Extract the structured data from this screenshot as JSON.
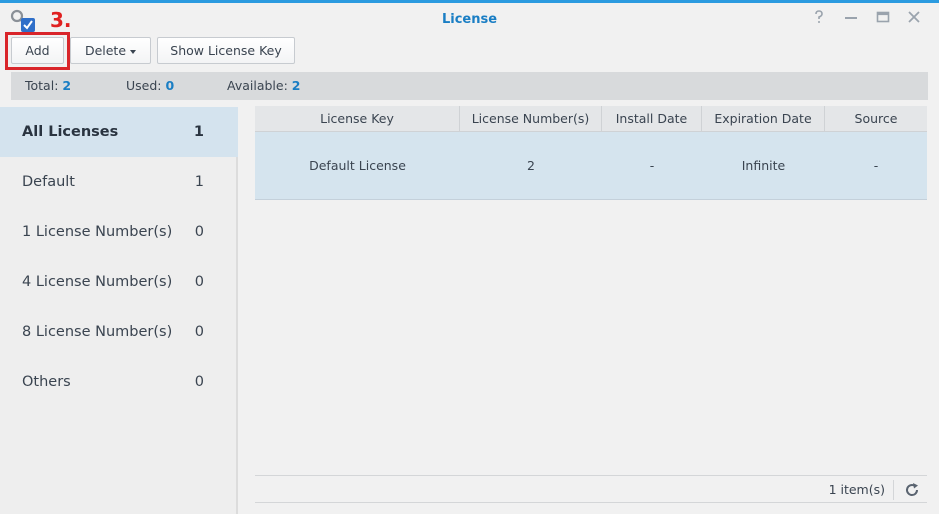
{
  "window": {
    "title": "License",
    "step_annotation": "3.",
    "controls": [
      "help-icon",
      "minimize-icon",
      "maximize-icon",
      "close-icon"
    ]
  },
  "toolbar": {
    "add_label": "Add",
    "delete_label": "Delete",
    "show_key_label": "Show License Key"
  },
  "summary": {
    "total_label": "Total:",
    "total_value": "2",
    "used_label": "Used:",
    "used_value": "0",
    "available_label": "Available:",
    "available_value": "2"
  },
  "sidebar": {
    "items": [
      {
        "label": "All Licenses",
        "count": "1",
        "active": true
      },
      {
        "label": "Default",
        "count": "1"
      },
      {
        "label": "1 License Number(s)",
        "count": "0"
      },
      {
        "label": "4 License Number(s)",
        "count": "0"
      },
      {
        "label": "8 License Number(s)",
        "count": "0"
      },
      {
        "label": "Others",
        "count": "0"
      }
    ]
  },
  "table": {
    "columns": [
      "License Key",
      "License Number(s)",
      "Install Date",
      "Expiration Date",
      "Source"
    ],
    "rows": [
      [
        "Default License",
        "2",
        "-",
        "Infinite",
        "-"
      ]
    ]
  },
  "footer": {
    "item_count": "1 item(s)"
  },
  "colors": {
    "accent": "#1a7ec4",
    "highlight": "#d9252a",
    "selected_row": "#d5e4ee"
  }
}
